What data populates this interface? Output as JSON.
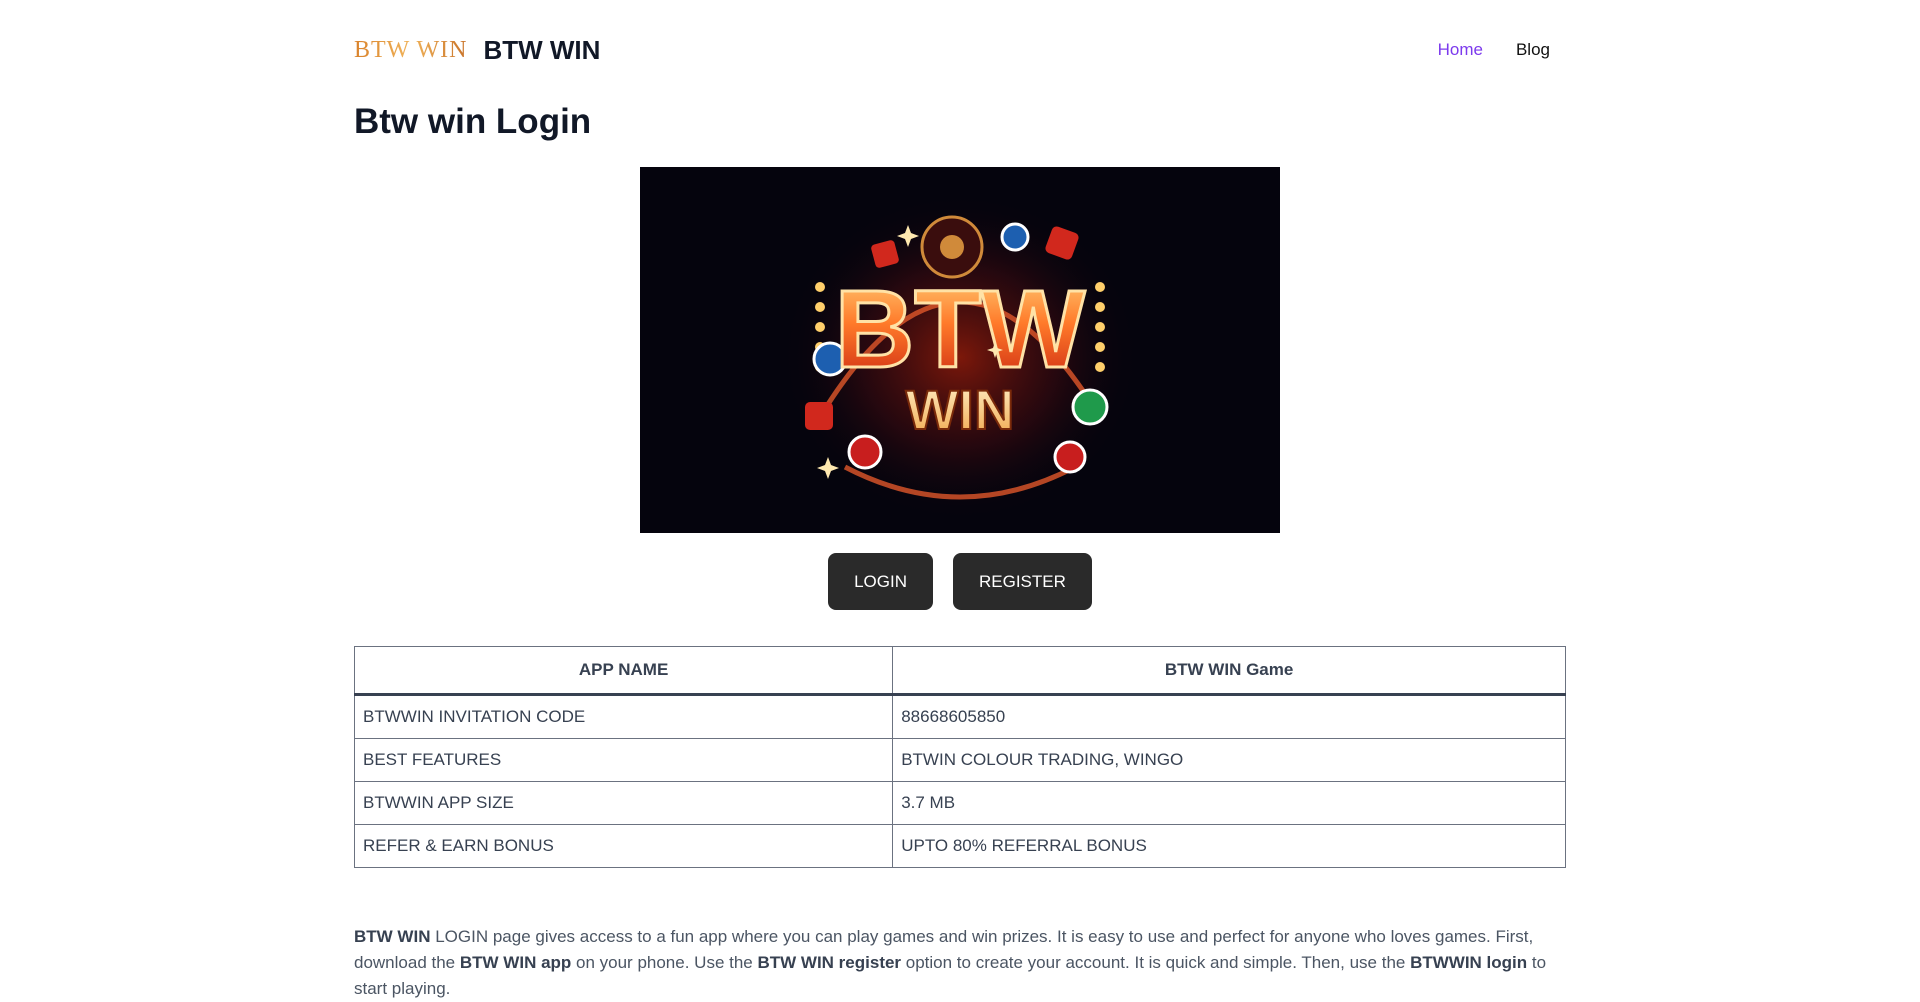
{
  "header": {
    "logo_text": "BTW WIN",
    "site_title": "BTW WIN",
    "nav": [
      {
        "label": "Home",
        "active": true
      },
      {
        "label": "Blog",
        "active": false
      }
    ]
  },
  "page": {
    "title": "Btw win Login"
  },
  "hero": {
    "text_top": "BTW",
    "text_bottom": "WIN"
  },
  "actions": {
    "login_label": "LOGIN",
    "register_label": "REGISTER"
  },
  "table": {
    "headers": [
      "APP NAME",
      "BTW WIN Game"
    ],
    "rows": [
      [
        "BTWWIN INVITATION CODE",
        "88668605850"
      ],
      [
        "BEST FEATURES",
        "BTWIN COLOUR TRADING, WINGO"
      ],
      [
        "BTWWIN APP SIZE",
        "3.7 MB"
      ],
      [
        "REFER & EARN BONUS",
        "UPTO 80% REFERRAL BONUS"
      ]
    ]
  },
  "intro": {
    "s1_bold": "BTW WIN",
    "s1_text": " LOGIN page gives access to a fun app where you can play games and win prizes. It is easy to use and perfect for anyone who loves games. First, download the ",
    "s2_bold": "BTW WIN app",
    "s2_text": " on your phone. Use the ",
    "s3_bold": "BTW WIN register",
    "s3_text": " option to create your account. It is quick and simple. Then, use the ",
    "s4_bold": "BTWWIN login",
    "s4_text": " to start playing."
  },
  "colors": {
    "nav_active": "#7c3aed",
    "button_bg": "#2a2a2a",
    "logo_gradient": [
      "#d9822b",
      "#f0b35a"
    ]
  }
}
